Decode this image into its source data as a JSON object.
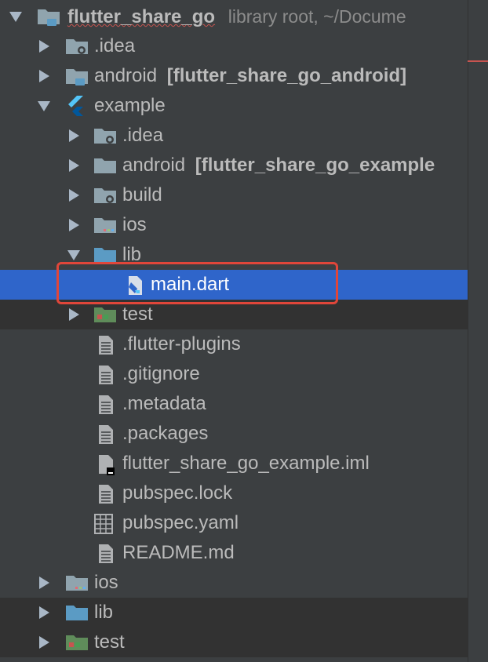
{
  "project": {
    "root_name": "flutter_share_go",
    "root_hint": "library root,  ~/Docume"
  },
  "rows": {
    "idea": ".idea",
    "android_name": "android",
    "android_module": "[flutter_share_go_android]",
    "example": "example",
    "ex_idea": ".idea",
    "ex_android_name": "android",
    "ex_android_module": "[flutter_share_go_example",
    "ex_build": "build",
    "ex_ios": "ios",
    "ex_lib": "lib",
    "ex_main": "main.dart",
    "ex_test": "test",
    "ex_flutter_plugins": ".flutter-plugins",
    "ex_gitignore": ".gitignore",
    "ex_metadata": ".metadata",
    "ex_packages": ".packages",
    "ex_iml": "flutter_share_go_example.iml",
    "ex_pubspec_lock": "pubspec.lock",
    "ex_pubspec_yaml": "pubspec.yaml",
    "ex_readme": "README.md",
    "ios": "ios",
    "lib": "lib",
    "test": "test"
  },
  "colors": {
    "background": "#3c3f41",
    "selection": "#2f65ca",
    "text": "#bbbbbb",
    "folder": "#90a4ae",
    "folder_blue": "#5b9bc4",
    "highlight_border": "#e0463a"
  }
}
